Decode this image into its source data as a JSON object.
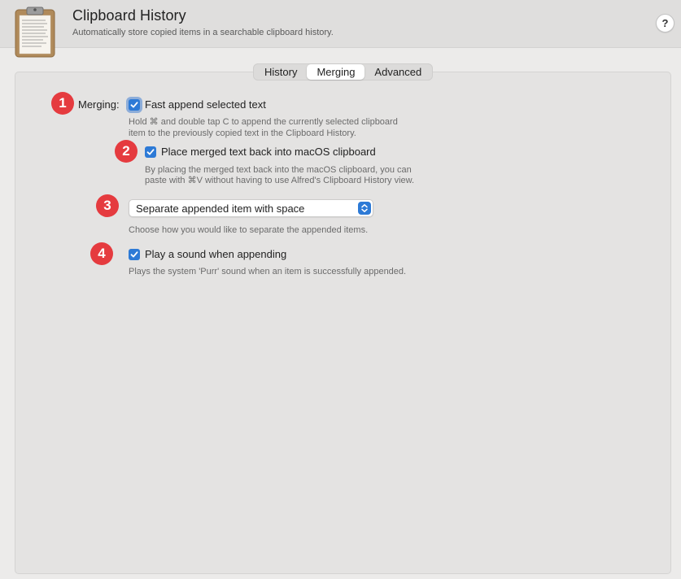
{
  "header": {
    "title": "Clipboard History",
    "subtitle": "Automatically store copied items in a searchable clipboard history.",
    "help_label": "?",
    "icon": "clipboard-icon"
  },
  "tabs": [
    {
      "label": "History",
      "active": false
    },
    {
      "label": "Merging",
      "active": true
    },
    {
      "label": "Advanced",
      "active": false
    }
  ],
  "merging": {
    "section_label": "Merging:",
    "badges": [
      "1",
      "2",
      "3",
      "4"
    ],
    "fast_append": {
      "label": "Fast append selected text",
      "checked": true,
      "desc_line1": "Hold ⌘ and double tap C to append the currently selected clipboard",
      "desc_line2": "item to the previously copied text in the Clipboard History."
    },
    "place_back": {
      "label": "Place merged text back into macOS clipboard",
      "checked": true,
      "desc_line1": "By placing the merged text back into the macOS clipboard, you can",
      "desc_line2": "paste with ⌘V without having to use Alfred's Clipboard History view."
    },
    "separator": {
      "selected": "Separate appended item with space",
      "desc": "Choose how you would like to separate the appended items."
    },
    "sound": {
      "label": "Play a sound when appending",
      "checked": true,
      "desc": "Plays the system 'Purr' sound when an item is successfully appended."
    }
  },
  "colors": {
    "accent": "#2d7ad6",
    "badge": "#e53b3f"
  }
}
